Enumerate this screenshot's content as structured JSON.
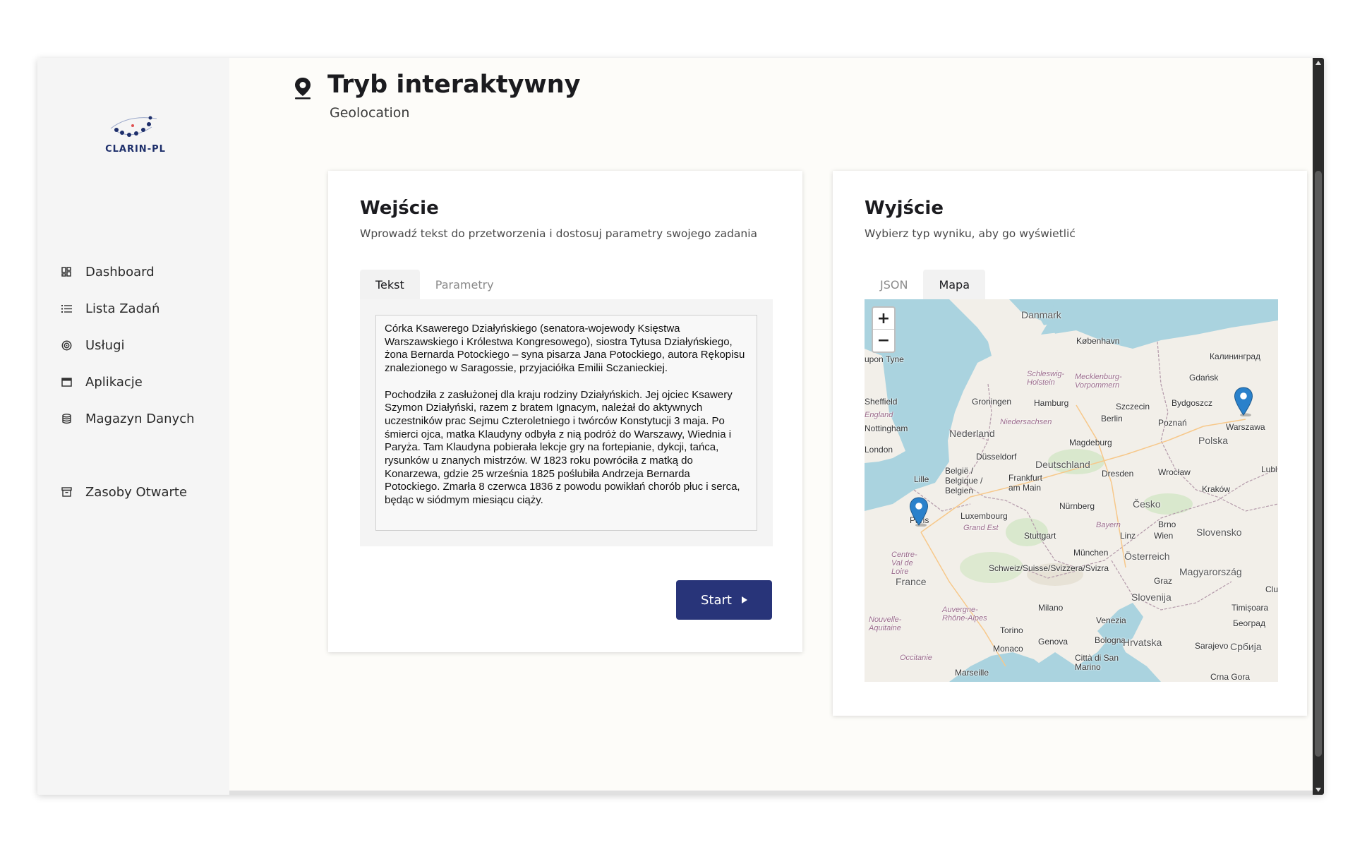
{
  "brand": {
    "logo_text": "CLARIN-PL"
  },
  "sidebar": {
    "items": [
      {
        "label": "Dashboard",
        "icon": "dashboard-icon"
      },
      {
        "label": "Lista Zadań",
        "icon": "list-icon"
      },
      {
        "label": "Usługi",
        "icon": "services-icon"
      },
      {
        "label": "Aplikacje",
        "icon": "app-window-icon"
      },
      {
        "label": "Magazyn Danych",
        "icon": "database-icon"
      },
      {
        "label": "Zasoby Otwarte",
        "icon": "archive-icon"
      }
    ]
  },
  "header": {
    "title": "Tryb interaktywny",
    "subtitle": "Geolocation",
    "icon": "map-pin-icon"
  },
  "input": {
    "title": "Wejście",
    "description": "Wprowadź tekst do przetworzenia i dostosuj parametry swojego zadania",
    "tabs": [
      "Tekst",
      "Parametry"
    ],
    "active_tab": "Tekst",
    "text": "Córka Ksawerego Działyńskiego (senatora-wojewody Księstwa Warszawskiego i Królestwa Kongresowego), siostra Tytusa Działyńskiego, żona Bernarda Potockiego – syna pisarza Jana Potockiego, autora Rękopisu znalezionego w Saragossie, przyjaciółka Emilii Sczanieckiej.\n\nPochodziła z zasłużonej dla kraju rodziny Działyńskich. Jej ojciec Ksawery Szymon Działyński, razem z bratem Ignacym, należał do aktywnych uczestników prac Sejmu Czteroletniego i twórców Konstytucji 3 maja. Po śmierci ojca, matka Klaudyny odbyła z nią podróż do Warszawy, Wiednia i Paryża. Tam Klaudyna pobierała lekcje gry na fortepianie, dykcji, tańca, rysunków u znanych mistrzów. W 1823 roku powróciła z matką do Konarzewa, gdzie 25 września 1825 poślubiła Andrzeja Bernarda Potockiego. Zmarła 8 czerwca 1836 z powodu powikłań chorób płuc i serca, będąc w siódmym miesiącu ciąży.",
    "start_label": "Start"
  },
  "output": {
    "title": "Wyjście",
    "description": "Wybierz typ wyniku, aby go wyświetlić",
    "tabs": [
      "JSON",
      "Mapa"
    ],
    "active_tab": "Mapa",
    "map": {
      "zoom_in": "+",
      "zoom_out": "−",
      "markers": [
        "Paris",
        "Warszawa"
      ],
      "labels": {
        "danmark": "Danmark",
        "kobenhavn": "København",
        "kaliningrad": "Калининград",
        "gdansk": "Gdańsk",
        "bydgoszcz": "Bydgoszcz",
        "warszawa": "Warszawa",
        "polska": "Polska",
        "poznan": "Poznań",
        "szczecin": "Szczecin",
        "berlin": "Berlin",
        "hamburg": "Hamburg",
        "groningen": "Groningen",
        "nederland": "Nederland",
        "niedersachsen": "Niedersachsen",
        "schleswig": "Schleswig-Holstein",
        "mecklenburg": "Mecklenburg-Vorpommern",
        "magdeburg": "Magdeburg",
        "deutschland": "Deutschland",
        "dusseldorf": "Düsseldorf",
        "belgie": "België / Belgique / Belgien",
        "frankfurt": "Frankfurt am Main",
        "dresden": "Dresden",
        "wroclaw": "Wrocław",
        "krakow": "Kraków",
        "lille": "Lille",
        "london": "London",
        "sheffield": "Sheffield",
        "nottingham": "Nottingham",
        "england": "England",
        "newcastle": "upon Tyne",
        "paris": "Paris",
        "luxembourg": "Luxembourg",
        "grandest": "Grand Est",
        "nurnberg": "Nürnberg",
        "cesko": "Česko",
        "stuttgart": "Stuttgart",
        "bayern": "Bayern",
        "brno": "Brno",
        "wien": "Wien",
        "linz": "Linz",
        "slovensko": "Slovensko",
        "munchen": "München",
        "osterreich": "Österreich",
        "centre": "Centre-Val de Loire",
        "france": "France",
        "schweiz": "Schweiz/Suisse/Svizzera/Svizra",
        "graz": "Graz",
        "magyarorszag": "Magyarország",
        "slovenija": "Slovenija",
        "milano": "Milano",
        "venezia": "Venezia",
        "torino": "Torino",
        "auvergne": "Auvergne-Rhône-Alpes",
        "nouvelle": "Nouvelle-Aquitaine",
        "genova": "Genova",
        "bologna": "Bologna",
        "hrvatska": "Hrvatska",
        "monaco": "Monaco",
        "occitanie": "Occitanie",
        "sanmarino": "Città di San Marino",
        "marseille": "Marseille",
        "timisoara": "Timișoara",
        "beograd": "Београд",
        "sarajevo": "Sarajevo",
        "srbija": "Србија",
        "crnagora": "Crna Gora",
        "lublin": "Lubl",
        "cluj": "Clu"
      }
    }
  },
  "colors": {
    "brand_navy": "#283479",
    "marker_blue": "#2a81cb",
    "sea": "#aad3df",
    "land": "#f2efe9"
  }
}
